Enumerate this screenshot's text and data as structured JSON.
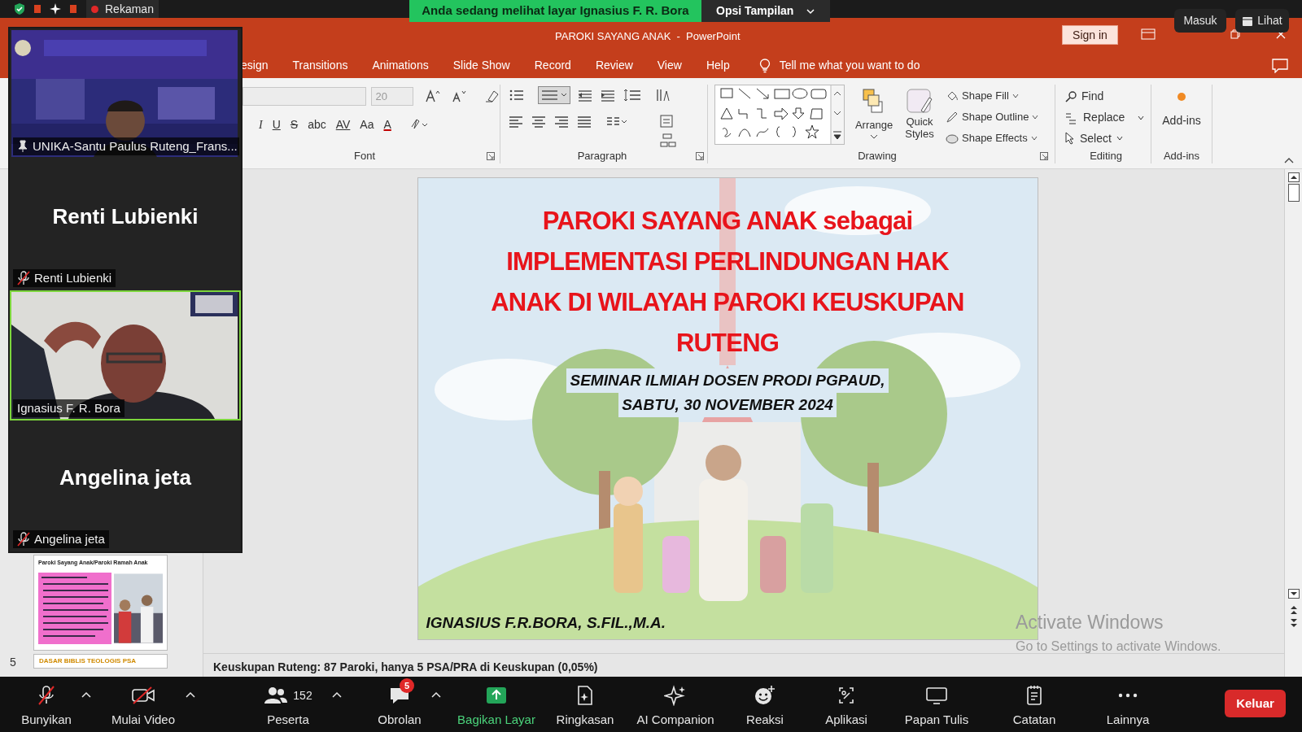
{
  "zoom_top_bar": {
    "recording_label": "Rekaman",
    "sharing_banner": "Anda sedang melihat layar Ignasius F. R. Bora",
    "view_options": "Opsi Tampilan",
    "sign_in": "Masuk",
    "view": "Lihat"
  },
  "powerpoint": {
    "title": "PAROKI SAYANG ANAK  -  PowerPoint",
    "sign_in": "Sign in",
    "tabs": [
      {
        "label": "esign",
        "selected": false
      },
      {
        "label": "Transitions",
        "selected": false
      },
      {
        "label": "Animations",
        "selected": false
      },
      {
        "label": "Slide Show",
        "selected": false
      },
      {
        "label": "Record",
        "selected": false
      },
      {
        "label": "Review",
        "selected": false
      },
      {
        "label": "View",
        "selected": false
      },
      {
        "label": "Help",
        "selected": false
      }
    ],
    "tell_me": "Tell me what you want to do"
  },
  "ribbon": {
    "font_size": "20",
    "font_buttons": [
      "I",
      "U",
      "S",
      "abc",
      "AV",
      "Aa",
      "A"
    ],
    "groups": [
      "Font",
      "Paragraph",
      "Drawing",
      "Editing",
      "Add-ins"
    ],
    "drawing_buttons": [
      "Arrange",
      "Quick Styles"
    ],
    "shape_buttons": [
      "Shape Fill",
      "Shape Outline",
      "Shape Effects"
    ],
    "editing_buttons": [
      "Find",
      "Replace",
      "Select"
    ],
    "addins_button": "Add-ins"
  },
  "thumbnails": [
    {
      "title": "Paroki Sayang Anak/Paroki Ramah Anak"
    },
    {
      "number": "5",
      "title": "DASAR BIBLIS TEOLOGIS PSA"
    }
  ],
  "slide": {
    "title_lines": [
      "PAROKI SAYANG ANAK sebagai",
      "IMPLEMENTASI PERLINDUNGAN HAK",
      "ANAK DI WILAYAH PAROKI KEUSKUPAN",
      "RUTENG"
    ],
    "subtitle_lines": [
      "SEMINAR ILMIAH DOSEN PRODI PGPAUD,",
      "SABTU, 30 NOVEMBER 2024"
    ],
    "author": "IGNASIUS F.R.BORA, S.FIL.,M.A."
  },
  "notes": "Keuskupan Ruteng: 87 Paroki, hanya 5 PSA/PRA di Keuskupan (0,05%)",
  "activation": {
    "title": "Activate Windows",
    "message": "Go to Settings to activate Windows."
  },
  "participants": [
    {
      "kind": "video",
      "name": "UNIKA-Santu Paulus Ruteng_Frans...",
      "pinned": true,
      "muted": false,
      "active_speaker": false
    },
    {
      "kind": "avatar",
      "display_name": "Renti Lubienki",
      "name": "Renti Lubienki",
      "pinned": false,
      "muted": true,
      "active_speaker": false
    },
    {
      "kind": "video",
      "name": "Ignasius F. R. Bora",
      "pinned": false,
      "muted": false,
      "active_speaker": true
    },
    {
      "kind": "avatar",
      "display_name": "Angelina jeta",
      "name": "Angelina jeta",
      "pinned": false,
      "muted": true,
      "active_speaker": false
    }
  ],
  "toolbar": {
    "items": [
      {
        "kind": "tool",
        "label": "Bunyikan",
        "caret": true
      },
      {
        "kind": "tool",
        "label": "Mulai Video",
        "caret": true
      },
      {
        "kind": "tool",
        "label": "Peserta",
        "caret": true,
        "count": "152"
      },
      {
        "kind": "tool",
        "label": "Obrolan",
        "caret": true,
        "badge": "5"
      },
      {
        "kind": "share",
        "label": "Bagikan Layar",
        "caret": false
      },
      {
        "kind": "tool",
        "label": "Ringkasan",
        "caret": false
      },
      {
        "kind": "tool",
        "label": "AI Companion",
        "caret": false
      },
      {
        "kind": "tool",
        "label": "Reaksi",
        "caret": false
      },
      {
        "kind": "tool",
        "label": "Aplikasi",
        "caret": false
      },
      {
        "kind": "tool",
        "label": "Papan Tulis",
        "caret": false
      },
      {
        "kind": "tool",
        "label": "Catatan",
        "caret": false
      },
      {
        "kind": "tool",
        "label": "Lainnya",
        "caret": false
      }
    ],
    "leave": "Keluar"
  }
}
